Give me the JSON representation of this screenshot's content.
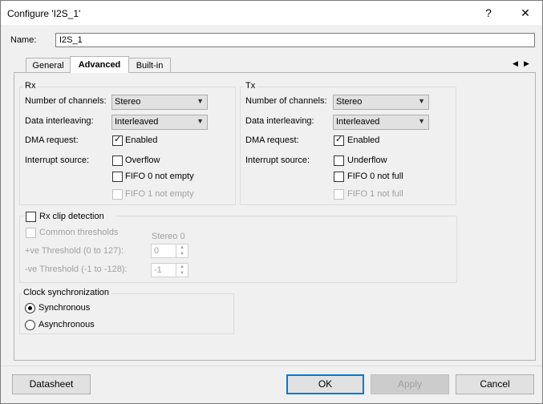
{
  "window": {
    "title": "Configure 'I2S_1'",
    "help_glyph": "?",
    "close_glyph": "✕"
  },
  "name_field": {
    "label": "Name:",
    "value": "I2S_1"
  },
  "tabs": [
    {
      "label": "General"
    },
    {
      "label": "Advanced",
      "active": true
    },
    {
      "label": "Built-in"
    }
  ],
  "tab_scroll": {
    "left": "◀",
    "right": "▶"
  },
  "rx": {
    "title": "Rx",
    "channels": {
      "label": "Number of channels:",
      "value": "Stereo"
    },
    "interleaving": {
      "label": "Data interleaving:",
      "value": "Interleaved"
    },
    "dma": {
      "label": "DMA request:",
      "checkbox_label": "Enabled",
      "checked": true
    },
    "interrupt": {
      "label": "Interrupt source:",
      "options": [
        "Overflow",
        "FIFO 0 not empty",
        "FIFO 1 not empty"
      ]
    }
  },
  "tx": {
    "title": "Tx",
    "channels": {
      "label": "Number of channels:",
      "value": "Stereo"
    },
    "interleaving": {
      "label": "Data interleaving:",
      "value": "Interleaved"
    },
    "dma": {
      "label": "DMA request:",
      "checkbox_label": "Enabled",
      "checked": true
    },
    "interrupt": {
      "label": "Interrupt source:",
      "options": [
        "Underflow",
        "FIFO 0 not full",
        "FIFO 1 not full"
      ]
    }
  },
  "clip": {
    "title": "Rx clip detection",
    "common_thresholds": "Common thresholds",
    "column_header": "Stereo 0",
    "pos_threshold": {
      "label": "+ve Threshold (0 to 127):",
      "value": "0"
    },
    "neg_threshold": {
      "label": "-ve Threshold (-1 to -128):",
      "value": "-1"
    }
  },
  "clock": {
    "title": "Clock synchronization",
    "options": [
      "Synchronous",
      "Asynchronous"
    ],
    "selected": "Synchronous"
  },
  "buttons": {
    "datasheet": "Datasheet",
    "ok": "OK",
    "apply": "Apply",
    "cancel": "Cancel"
  },
  "colors": {
    "accent": "#0078d7",
    "disabled_text": "#a0a0a0"
  }
}
